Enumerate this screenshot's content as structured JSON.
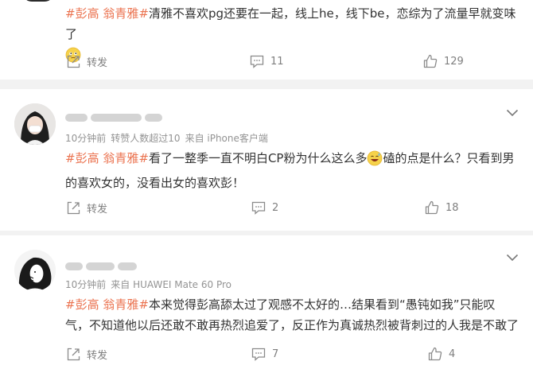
{
  "comments": [
    {
      "tags": [
        "#彭高",
        "翁青雅#"
      ],
      "text": "清雅不喜欢pg还要在一起，线上he，线下be，恋综为了流量早就变味了",
      "emoji": "doubt-emoji",
      "actions": {
        "repost": "转发",
        "comments": "11",
        "likes": "129"
      }
    },
    {
      "meta": {
        "time": "10分钟前",
        "likes_note": "转赞人数超过10",
        "source": "来自 iPhone客户端"
      },
      "tags": [
        "#彭高",
        "翁青雅#"
      ],
      "text_before_emoji": "看了一整季一直不明白CP粉为什么这么多",
      "emoji": "grin-sweat-emoji",
      "text_after_emoji": "磕的点是什么？只看到男的喜欢女的，没看出女的喜欢彭！",
      "actions": {
        "repost": "转发",
        "comments": "2",
        "likes": "18"
      }
    },
    {
      "meta": {
        "time": "10分钟前",
        "source": "来自 HUAWEI Mate 60 Pro"
      },
      "tags": [
        "#彭高",
        "翁青雅#"
      ],
      "text": "本来觉得彭高舔太过了观感不太好的…结果看到“愚钝如我”只能叹气，不知道他以后还敢不敢再热烈追爱了，反正作为真诚热烈被背刺过的人我是不敢了",
      "actions": {
        "repost": "转发",
        "comments": "7",
        "likes": "4"
      }
    }
  ],
  "colors": {
    "tag": "#eb7350",
    "meta": "#939393",
    "action": "#7f7f7f",
    "divider": "#f2f2f2"
  }
}
